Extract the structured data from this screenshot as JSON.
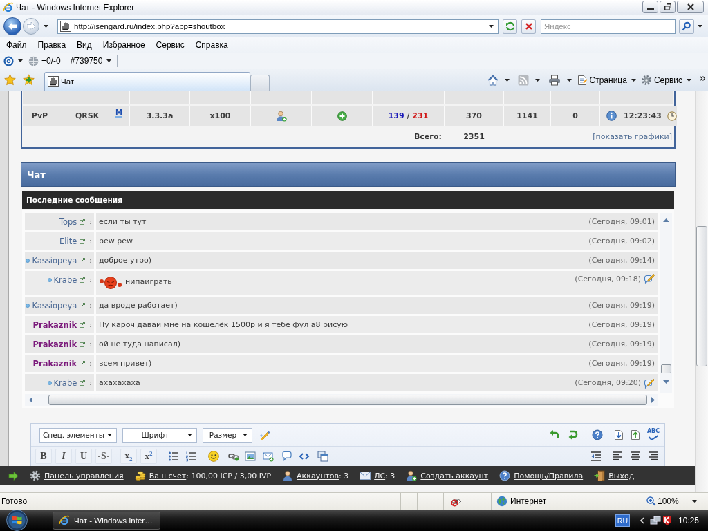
{
  "window": {
    "title": "Чат - Windows Internet Explorer"
  },
  "address_bar": {
    "url": "http://isengard.ru/index.php?app=shoutbox"
  },
  "search": {
    "placeholder": "Яндекс"
  },
  "menu": [
    "Файл",
    "Правка",
    "Вид",
    "Избранное",
    "Сервис",
    "Справка"
  ],
  "addon_toolbar": {
    "counter": "+0/-0",
    "number": "#739750"
  },
  "tabs": [
    {
      "label": "Чат",
      "selected": true
    }
  ],
  "command_bar": {
    "menus": [
      {
        "kind": "page",
        "label": "Страница"
      },
      {
        "kind": "tools",
        "label": "Сервис"
      }
    ]
  },
  "server_table": {
    "rows": [
      {
        "column_1": "PvP",
        "column_2": "QRSK",
        "column_2_mark": "M",
        "column_3": "3.3.3a",
        "column_4": "x100",
        "column_7": {
          "first": "139",
          "separator": "/",
          "second": "231"
        },
        "column_8": "370",
        "column_9": "1141",
        "column_10": "0",
        "column_11": "12:23:43"
      }
    ],
    "total_label": "Всего:",
    "total": "2351",
    "link": "[показать графики]"
  },
  "chat": {
    "title": "Чат",
    "subtitle": "Последние сообщения",
    "messages": [
      {
        "author": "Tops",
        "color": "#4a6894",
        "bold": false,
        "status_dot": false,
        "separator": ":",
        "emoticon": false,
        "text": "если ты тут",
        "time": "(Сегодня, 09:01)",
        "reply_icon": false
      },
      {
        "author": "Elite",
        "color": "#4a6894",
        "bold": false,
        "status_dot": false,
        "separator": ":",
        "emoticon": false,
        "text": "pew pew",
        "time": "(Сегодня, 09:02)",
        "reply_icon": false
      },
      {
        "author": "Kassiopeya",
        "color": "#4a6894",
        "bold": false,
        "status_dot": true,
        "separator": ":",
        "emoticon": false,
        "text": "доброе утро)",
        "time": "(Сегодня, 09:14)",
        "reply_icon": false
      },
      {
        "author": "Krabe",
        "color": "#4a6894",
        "bold": false,
        "status_dot": true,
        "separator": ":",
        "emoticon": true,
        "text": "нипаиграть",
        "time": "(Сегодня, 09:18)",
        "reply_icon": true
      },
      {
        "author": "Kassiopeya",
        "color": "#4a6894",
        "bold": false,
        "status_dot": true,
        "separator": ":",
        "emoticon": false,
        "text": "да вроде работает)",
        "time": "(Сегодня, 09:19)",
        "reply_icon": false
      },
      {
        "author": "Prakaznik",
        "color": "#7b1a7b",
        "bold": true,
        "status_dot": false,
        "separator": ":",
        "emoticon": false,
        "text": "Ну кароч давай мне на кошелёк 1500р и я тебе фул а8 рисую",
        "time": "(Сегодня, 09:19)",
        "reply_icon": false
      },
      {
        "author": "Prakaznik",
        "color": "#7b1a7b",
        "bold": true,
        "status_dot": false,
        "separator": ":",
        "emoticon": false,
        "text": "ой не туда написал)",
        "time": "(Сегодня, 09:19)",
        "reply_icon": false
      },
      {
        "author": "Prakaznik",
        "color": "#7b1a7b",
        "bold": true,
        "status_dot": false,
        "separator": ":",
        "emoticon": false,
        "text": "всем привет)",
        "time": "(Сегодня, 09:19)",
        "reply_icon": false
      },
      {
        "author": "Krabe",
        "color": "#4a6894",
        "bold": false,
        "status_dot": true,
        "separator": ":",
        "emoticon": false,
        "text": "ахахахаха",
        "time": "(Сегодня, 09:20)",
        "reply_icon": true
      }
    ]
  },
  "editor": {
    "dropdowns": [
      "Спец. элементы",
      "Шрифт",
      "Размер"
    ],
    "spellcheck_label": "ABC",
    "format_buttons": [
      {
        "kind": "bold",
        "label": "B"
      },
      {
        "kind": "italic",
        "label": "I"
      },
      {
        "kind": "underline",
        "label": "U"
      },
      {
        "kind": "strike",
        "label": "S"
      },
      {
        "kind": "sub",
        "label": "x$_{2}$"
      },
      {
        "kind": "sup",
        "label": "x$^{2}$"
      }
    ]
  },
  "bottom_bar": {
    "items": [
      {
        "kind": "settings",
        "link": "Панель управления",
        "value": ""
      },
      {
        "kind": "balance",
        "link": "Ваш счет",
        "value": ": 100,00 ICP / 3,00 IVP"
      },
      {
        "kind": "accounts",
        "link": "Аккаунтов",
        "value": ": 3"
      },
      {
        "kind": "messages",
        "link": "ЛС",
        "value": ": 3"
      },
      {
        "kind": "create",
        "link": "Создать аккаунт",
        "value": ""
      },
      {
        "kind": "help",
        "link": "Помощь/Правила",
        "value": ""
      },
      {
        "kind": "exit",
        "link": "Выход",
        "value": ""
      }
    ]
  },
  "status_bar": {
    "text": "Готово",
    "zone": "Интернет",
    "zoom": "100%"
  },
  "taskbar": {
    "task": "Чат - Windows Inter…",
    "language": "RU",
    "clock": "10:25"
  }
}
